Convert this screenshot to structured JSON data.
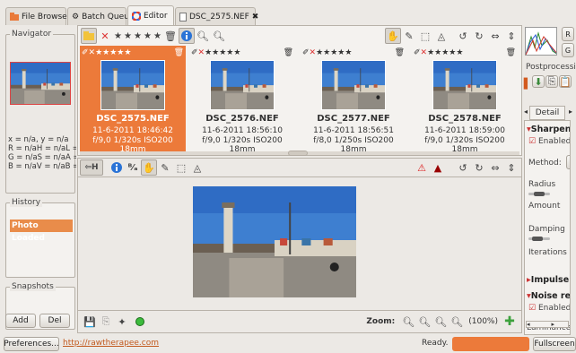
{
  "tabs": [
    {
      "label": "File Browser"
    },
    {
      "label": "Batch Queue"
    },
    {
      "label": "Editor"
    },
    {
      "label": "DSC_2575.NEF"
    }
  ],
  "left": {
    "navigator_title": "Navigator",
    "nav_info": [
      "x = n/a, y = n/a",
      "R = n/aH = n/aL =",
      "G = n/aS = n/aA =",
      "B = n/aV = n/aB ="
    ],
    "history_title": "History",
    "history_items": [
      "Photo Loaded"
    ],
    "snapshots_title": "Snapshots",
    "add_label": "Add",
    "del_label": "Del"
  },
  "filmstrip": {
    "thumbs": [
      {
        "name": "DSC_2575.NEF",
        "date": "11-6-2011 18:46:42",
        "exif": "f/9,0 1/320s ISO200 18mm",
        "selected": true
      },
      {
        "name": "DSC_2576.NEF",
        "date": "11-6-2011 18:56:10",
        "exif": "f/9,0 1/320s ISO200 18mm"
      },
      {
        "name": "DSC_2577.NEF",
        "date": "11-6-2011 18:56:51",
        "exif": "f/8,0 1/250s ISO200 18mm"
      },
      {
        "name": "DSC_2578.NEF",
        "date": "11-6-2011 18:59:00",
        "exif": "f/9,0 1/320s ISO200 18mm"
      }
    ]
  },
  "main_toolbar": {
    "h_label": "H"
  },
  "bottom": {
    "zoom_label": "Zoom:",
    "zoom_value": "(100%)"
  },
  "right": {
    "postprocessing_label": "Postprocessin",
    "detail_tab": "Detail",
    "sharpen_label": "Sharpen",
    "enabled_label": "Enabled",
    "method_label": "Method:",
    "radius_label": "Radius",
    "amount_label": "Amount",
    "damping_label": "Damping",
    "iterations_label": "Iterations",
    "impulse_label": "Impulse",
    "noise_label": "Noise re",
    "enabled2_label": "Enabled",
    "luminance_label": "Luminance",
    "r_label": "R",
    "g_label": "G"
  },
  "status": {
    "prefs_label": "Preferences...",
    "url": "http://rawtherapee.com",
    "ready": "Ready.",
    "fullscreen_label": "Fullscreen"
  },
  "colors": {
    "accent": "#ec7a3a",
    "link": "#c25a1e"
  }
}
